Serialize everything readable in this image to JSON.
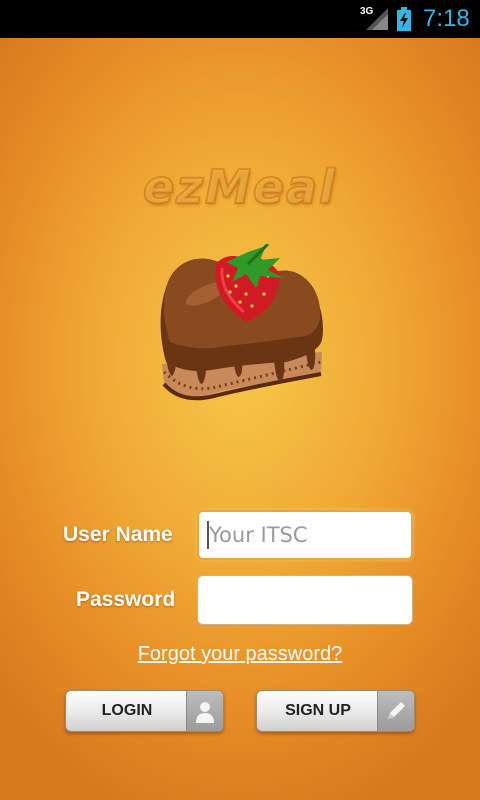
{
  "status_bar": {
    "network": "3G",
    "time": "7:18"
  },
  "logo": {
    "text": "ezMeal"
  },
  "form": {
    "username_label": "User Name",
    "username_placeholder": "Your ITSC",
    "password_label": "Password",
    "forgot_link": "Forgot your password?"
  },
  "buttons": {
    "login": "LOGIN",
    "signup": "SIGN UP"
  },
  "colors": {
    "status_accent": "#33b5e5",
    "background": "#f0a733",
    "field_focus": "#e3a640"
  },
  "icons": {
    "login": "user-icon",
    "signup": "pencil-icon",
    "hero": "chocolate-heart-cake-image"
  }
}
